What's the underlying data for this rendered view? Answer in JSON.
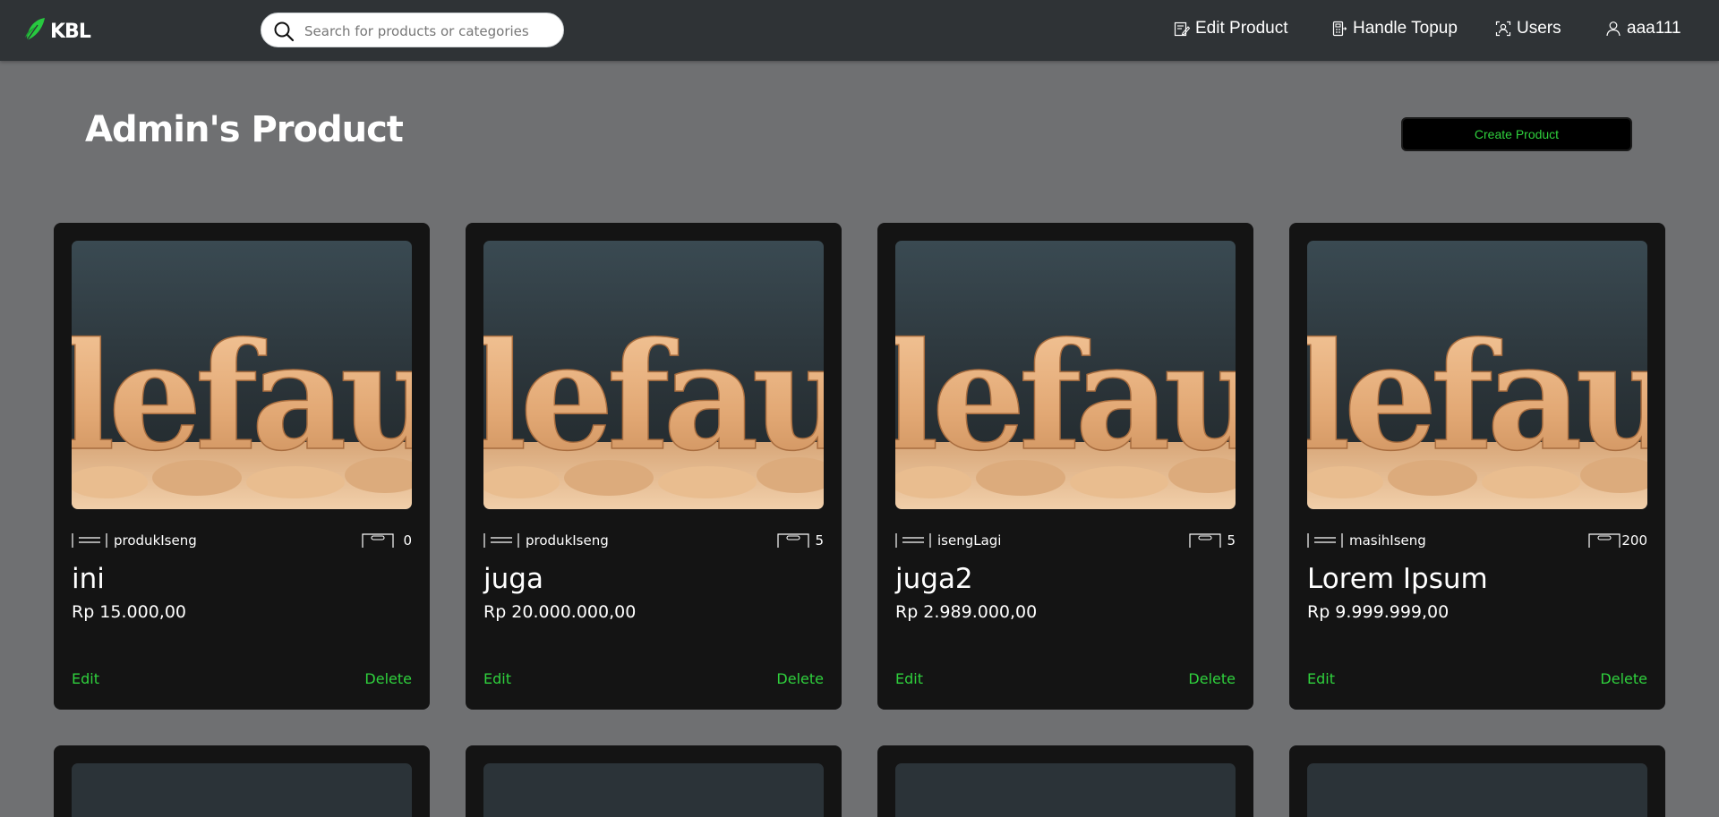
{
  "brand": {
    "name": "KBL",
    "accent": "#2fd13d"
  },
  "search": {
    "placeholder": "Search for products or categories"
  },
  "nav": {
    "edit_product": "Edit Product",
    "handle_topup": "Handle Topup",
    "users": "Users",
    "username": "aaa111"
  },
  "page": {
    "title": "Admin's Product",
    "create_button": "Create Product"
  },
  "image_text": "lefaul",
  "products": [
    {
      "category": "produkIseng",
      "stock": "0",
      "name": "ini",
      "price": "Rp 15.000,00",
      "edit": "Edit",
      "delete": "Delete"
    },
    {
      "category": "produkIseng",
      "stock": "5",
      "name": "juga",
      "price": "Rp 20.000.000,00",
      "edit": "Edit",
      "delete": "Delete"
    },
    {
      "category": "isengLagi",
      "stock": "5",
      "name": "juga2",
      "price": "Rp 2.989.000,00",
      "edit": "Edit",
      "delete": "Delete"
    },
    {
      "category": "masihIseng",
      "stock": "200",
      "name": "Lorem Ipsum",
      "price": "Rp 9.999.999,00",
      "edit": "Edit",
      "delete": "Delete"
    }
  ]
}
